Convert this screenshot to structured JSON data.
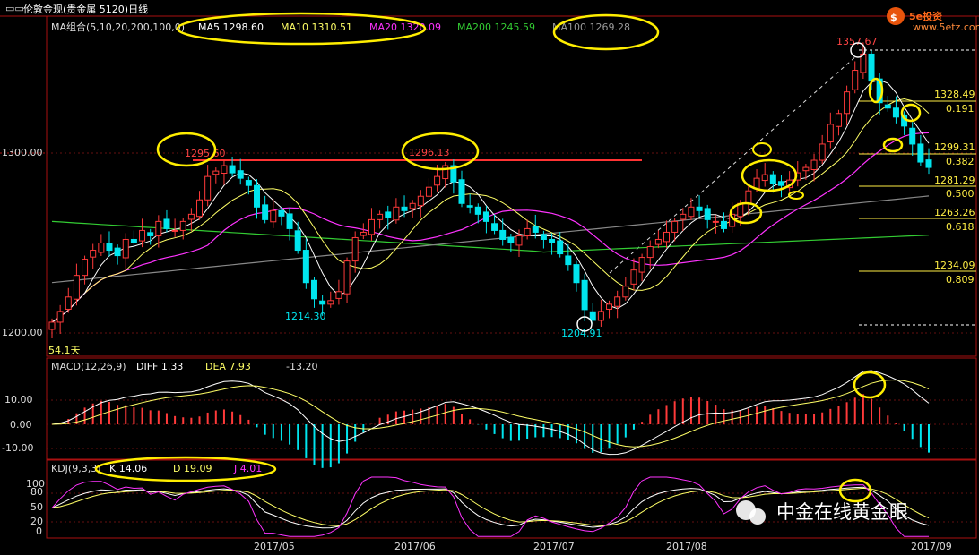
{
  "header": {
    "title": "伦敦金现(贵金属 5120)日线",
    "ma_group_label": "MA组合(5,10,20,200,100,0)",
    "ma5": "MA5 1298.60",
    "ma10": "MA10 1310.51",
    "ma20": "MA20 1320.09",
    "ma200": "MA200 1245.59",
    "ma100": "MA100 1269.28"
  },
  "logo": {
    "text": "5e投资",
    "url": "www.5etz.com"
  },
  "watermark": "中金在线黄金眼",
  "price_axis": {
    "labels": [
      "1300.00",
      "1200.00"
    ]
  },
  "price_annotations": {
    "high1": "1295.60",
    "high2": "1296.13",
    "peak": "1357.67",
    "low1": "1214.30",
    "low2": "1204.91",
    "left_label": "54.1天"
  },
  "fib_levels": [
    {
      "price": "1328.49",
      "ratio": "0.191"
    },
    {
      "price": "1299.31",
      "ratio": "0.382"
    },
    {
      "price": "1281.29",
      "ratio": "0.500"
    },
    {
      "price": "1263.26",
      "ratio": "0.618"
    },
    {
      "price": "1234.09",
      "ratio": "0.809"
    }
  ],
  "macd": {
    "label": "MACD(12,26,9)",
    "diff": "DIFF  1.33",
    "dea": "DEA  7.93",
    "macd": "-13.20",
    "axis": [
      "10.00",
      "0.00",
      "-10.00"
    ]
  },
  "kdj": {
    "label": "KDJ(9,3,3)",
    "k": "K  14.06",
    "d": "D  19.09",
    "j": "J  4.01",
    "axis": [
      "100",
      "80",
      "50",
      "20",
      "0"
    ]
  },
  "date_axis": [
    "2017/05",
    "2017/06",
    "2017/07",
    "2017/08",
    "2017/09"
  ],
  "colors": {
    "up": "#ff3a3a",
    "down": "#00e5ee",
    "ma5": "#ffffff",
    "ma10": "#ffff66",
    "ma20": "#ff33ff",
    "ma200": "#33cc33",
    "ma100": "#999999",
    "highlight": "#ffee00"
  },
  "chart_data": {
    "type": "candlestick",
    "title": "伦敦金现(贵金属 5120)日线",
    "ylim": [
      1195,
      1365
    ],
    "closes": [
      1206,
      1212,
      1220,
      1232,
      1241,
      1246,
      1250,
      1246,
      1243,
      1252,
      1250,
      1257,
      1254,
      1262,
      1258,
      1257,
      1262,
      1266,
      1274,
      1287,
      1290,
      1293,
      1289,
      1286,
      1282,
      1270,
      1263,
      1268,
      1265,
      1258,
      1246,
      1228,
      1219,
      1216,
      1218,
      1223,
      1240,
      1253,
      1256,
      1263,
      1266,
      1264,
      1270,
      1268,
      1272,
      1276,
      1281,
      1287,
      1293,
      1284,
      1272,
      1270,
      1266,
      1262,
      1257,
      1252,
      1250,
      1254,
      1258,
      1256,
      1252,
      1250,
      1244,
      1238,
      1228,
      1213,
      1207,
      1212,
      1216,
      1220,
      1226,
      1235,
      1242,
      1248,
      1252,
      1256,
      1262,
      1266,
      1270,
      1268,
      1263,
      1262,
      1258,
      1266,
      1272,
      1279,
      1286,
      1288,
      1283,
      1282,
      1285,
      1289,
      1292,
      1296,
      1305,
      1316,
      1322,
      1334,
      1346,
      1355,
      1340,
      1328,
      1325,
      1320,
      1315,
      1305,
      1295,
      1292
    ]
  }
}
